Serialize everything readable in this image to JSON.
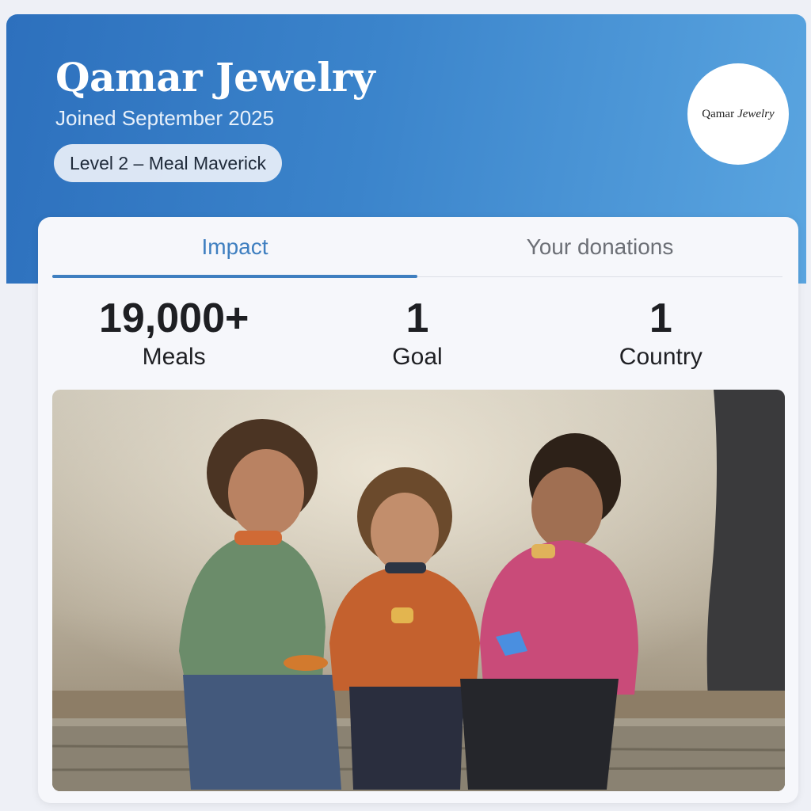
{
  "profile": {
    "name": "Qamar Jewelry",
    "joined": "Joined September 2025",
    "level": "Level 2 – Meal Maverick",
    "logo_text_a": "Qamar",
    "logo_text_b": "Jewelry"
  },
  "tabs": [
    {
      "label": "Impact",
      "active": true
    },
    {
      "label": "Your donations",
      "active": false
    }
  ],
  "stats": [
    {
      "value": "19,000+",
      "label": "Meals"
    },
    {
      "value": "1",
      "label": "Goal"
    },
    {
      "value": "1",
      "label": "Country"
    }
  ],
  "colors": {
    "header_start": "#2d70bd",
    "header_end": "#5aa5e0",
    "accent": "#3f7fc0"
  }
}
